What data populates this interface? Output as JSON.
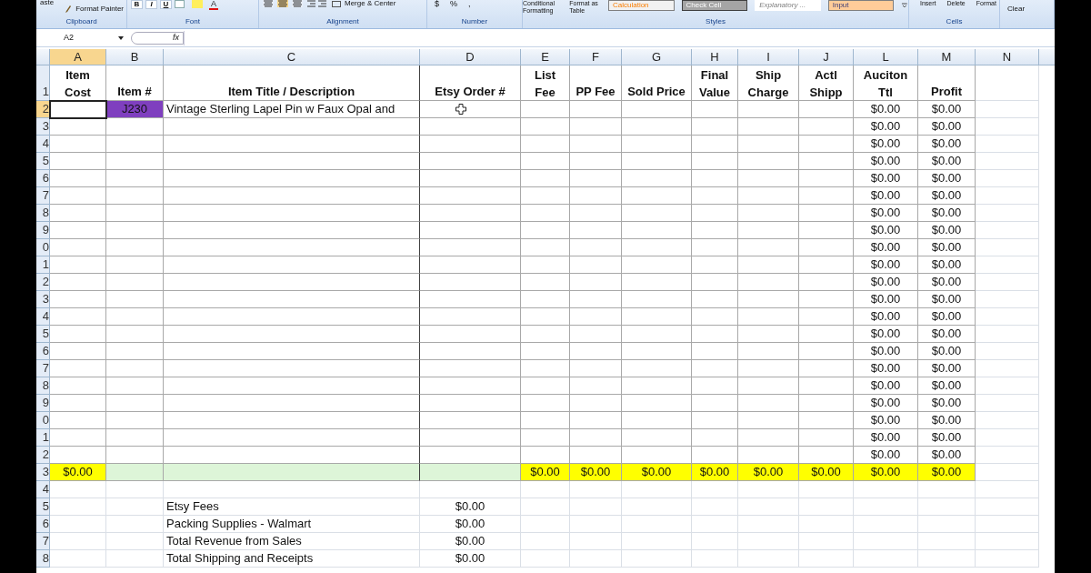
{
  "ribbon": {
    "groups": [
      {
        "kind": "clipboard",
        "label": "Clipboard",
        "items": [
          "aste",
          "Format Painter"
        ]
      },
      {
        "kind": "font",
        "label": "Font",
        "items": [
          "B",
          "I",
          "U",
          "A"
        ]
      },
      {
        "kind": "alignment",
        "label": "Alignment",
        "items": [
          "Merge & Center"
        ]
      },
      {
        "kind": "number",
        "label": "Number",
        "items": [
          "$",
          "%",
          ","
        ]
      },
      {
        "kind": "styles",
        "label": "Styles",
        "items": [
          "Conditional Formatting",
          "Format as Table"
        ],
        "styles": [
          {
            "label": "Calculation",
            "kind": "outlined",
            "color": "#f2f2f2"
          },
          {
            "label": "Check Cell",
            "kind": "dark",
            "color": "#a5a5a5"
          },
          {
            "label": "Explanatory ...",
            "kind": "plain",
            "color": "#ffffff"
          },
          {
            "label": "Input",
            "kind": "filled",
            "color": "#ffcc99"
          }
        ]
      },
      {
        "kind": "cells",
        "label": "Cells",
        "items": [
          "Insert",
          "Delete",
          "Format"
        ]
      },
      {
        "kind": "editing",
        "items": [
          "Clear"
        ]
      }
    ]
  },
  "formula_bar": {
    "name_box": "A2",
    "fx": "fx"
  },
  "columns": [
    {
      "letter": "A",
      "header": [
        "Item",
        "Cost"
      ],
      "selected": true
    },
    {
      "letter": "B",
      "header": [
        "Item #"
      ],
      "selected": false
    },
    {
      "letter": "C",
      "header": [
        "Item Title / Description"
      ],
      "selected": false
    },
    {
      "letter": "D",
      "header": [
        "Etsy Order #"
      ],
      "selected": false
    },
    {
      "letter": "E",
      "header": [
        "List",
        "Fee"
      ],
      "selected": false
    },
    {
      "letter": "F",
      "header": [
        "PP Fee"
      ],
      "selected": false
    },
    {
      "letter": "G",
      "header": [
        "Sold Price"
      ],
      "selected": false
    },
    {
      "letter": "H",
      "header": [
        "Final",
        "Value"
      ],
      "selected": false
    },
    {
      "letter": "I",
      "header": [
        "Ship",
        "Charge"
      ],
      "selected": false
    },
    {
      "letter": "J",
      "header": [
        "Actl",
        "Shipp"
      ],
      "selected": false
    },
    {
      "letter": "L",
      "header": [
        "Auciton",
        "Ttl"
      ],
      "selected": false
    },
    {
      "letter": "M",
      "header": [
        "Profit"
      ],
      "selected": false
    },
    {
      "letter": "N",
      "selected": false
    }
  ],
  "header_row_label": "1",
  "rows": [
    {
      "label": "2",
      "kind": "data",
      "selected": true,
      "cells": {
        "B": {
          "text": "J230",
          "color": "#7f3fbf"
        },
        "D": {
          "cursor": true
        },
        "C": {
          "text": "Vintage Sterling Lapel Pin w Faux Opal and"
        },
        "L": {
          "text": "$0.00"
        },
        "M": {
          "text": "$0.00"
        }
      }
    },
    {
      "label": "3",
      "kind": "data",
      "selected": false,
      "cells": {
        "L": {
          "text": "$0.00"
        },
        "M": {
          "text": "$0.00"
        }
      }
    },
    {
      "label": "4",
      "kind": "data",
      "selected": false,
      "cells": {
        "L": {
          "text": "$0.00"
        },
        "M": {
          "text": "$0.00"
        }
      }
    },
    {
      "label": "5",
      "kind": "data",
      "selected": false,
      "cells": {
        "L": {
          "text": "$0.00"
        },
        "M": {
          "text": "$0.00"
        }
      }
    },
    {
      "label": "6",
      "kind": "data",
      "selected": false,
      "cells": {
        "L": {
          "text": "$0.00"
        },
        "M": {
          "text": "$0.00"
        }
      }
    },
    {
      "label": "7",
      "kind": "data",
      "selected": false,
      "cells": {
        "L": {
          "text": "$0.00"
        },
        "M": {
          "text": "$0.00"
        }
      }
    },
    {
      "label": "8",
      "kind": "data",
      "selected": false,
      "cells": {
        "L": {
          "text": "$0.00"
        },
        "M": {
          "text": "$0.00"
        }
      }
    },
    {
      "label": "9",
      "kind": "data",
      "selected": false,
      "cells": {
        "L": {
          "text": "$0.00"
        },
        "M": {
          "text": "$0.00"
        }
      }
    },
    {
      "label": "0",
      "kind": "data",
      "selected": false,
      "cells": {
        "L": {
          "text": "$0.00"
        },
        "M": {
          "text": "$0.00"
        }
      }
    },
    {
      "label": "1",
      "kind": "data",
      "selected": false,
      "cells": {
        "L": {
          "text": "$0.00"
        },
        "M": {
          "text": "$0.00"
        }
      }
    },
    {
      "label": "2",
      "kind": "data",
      "selected": false,
      "cells": {
        "L": {
          "text": "$0.00"
        },
        "M": {
          "text": "$0.00"
        }
      }
    },
    {
      "label": "3",
      "kind": "data",
      "selected": false,
      "cells": {
        "L": {
          "text": "$0.00"
        },
        "M": {
          "text": "$0.00"
        }
      }
    },
    {
      "label": "4",
      "kind": "data",
      "selected": false,
      "cells": {
        "L": {
          "text": "$0.00"
        },
        "M": {
          "text": "$0.00"
        }
      }
    },
    {
      "label": "5",
      "kind": "data",
      "selected": false,
      "cells": {
        "L": {
          "text": "$0.00"
        },
        "M": {
          "text": "$0.00"
        }
      }
    },
    {
      "label": "6",
      "kind": "data",
      "selected": false,
      "cells": {
        "L": {
          "text": "$0.00"
        },
        "M": {
          "text": "$0.00"
        }
      }
    },
    {
      "label": "7",
      "kind": "data",
      "selected": false,
      "cells": {
        "L": {
          "text": "$0.00"
        },
        "M": {
          "text": "$0.00"
        }
      }
    },
    {
      "label": "8",
      "kind": "data",
      "selected": false,
      "cells": {
        "L": {
          "text": "$0.00"
        },
        "M": {
          "text": "$0.00"
        }
      }
    },
    {
      "label": "9",
      "kind": "data",
      "selected": false,
      "cells": {
        "L": {
          "text": "$0.00"
        },
        "M": {
          "text": "$0.00"
        }
      }
    },
    {
      "label": "0",
      "kind": "data",
      "selected": false,
      "cells": {
        "L": {
          "text": "$0.00"
        },
        "M": {
          "text": "$0.00"
        }
      }
    },
    {
      "label": "1",
      "kind": "data",
      "selected": false,
      "cells": {
        "L": {
          "text": "$0.00"
        },
        "M": {
          "text": "$0.00"
        }
      }
    },
    {
      "label": "2",
      "kind": "data",
      "selected": false,
      "cells": {
        "L": {
          "text": "$0.00"
        },
        "M": {
          "text": "$0.00"
        }
      }
    },
    {
      "label": "3",
      "kind": "total",
      "selected": false,
      "cells": {
        "A": {
          "text": "$0.00",
          "color": "#ffff00"
        },
        "B": {
          "color": "#ddf5d8"
        },
        "C": {
          "color": "#ddf5d8"
        },
        "D": {
          "color": "#ddf5d8"
        },
        "E": {
          "text": "$0.00",
          "color": "#ffff00"
        },
        "F": {
          "text": "$0.00",
          "color": "#ffff00"
        },
        "G": {
          "text": "$0.00",
          "color": "#ffff00"
        },
        "H": {
          "text": "$0.00",
          "color": "#ffff00"
        },
        "I": {
          "text": "$0.00",
          "color": "#ffff00"
        },
        "J": {
          "text": "$0.00",
          "color": "#ffff00"
        },
        "L": {
          "text": "$0.00",
          "color": "#ffff00"
        },
        "M": {
          "text": "$0.00",
          "color": "#ffff00"
        }
      }
    },
    {
      "label": "4",
      "kind": "summary",
      "selected": false,
      "cells": {}
    },
    {
      "label": "5",
      "kind": "summary",
      "selected": false,
      "cells": {
        "C": {
          "text": "Etsy Fees"
        },
        "D": {
          "text": "$0.00"
        }
      }
    },
    {
      "label": "6",
      "kind": "summary",
      "selected": false,
      "cells": {
        "C": {
          "text": "Packing Supplies - Walmart"
        },
        "D": {
          "text": "$0.00"
        }
      }
    },
    {
      "label": "7",
      "kind": "summary",
      "selected": false,
      "cells": {
        "C": {
          "text": "Total Revenue from Sales"
        },
        "D": {
          "text": "$0.00"
        }
      }
    },
    {
      "label": "8",
      "kind": "summary",
      "selected": false,
      "cells": {
        "C": {
          "text": "Total Shipping and Receipts"
        },
        "D": {
          "text": "$0.00"
        }
      }
    }
  ]
}
